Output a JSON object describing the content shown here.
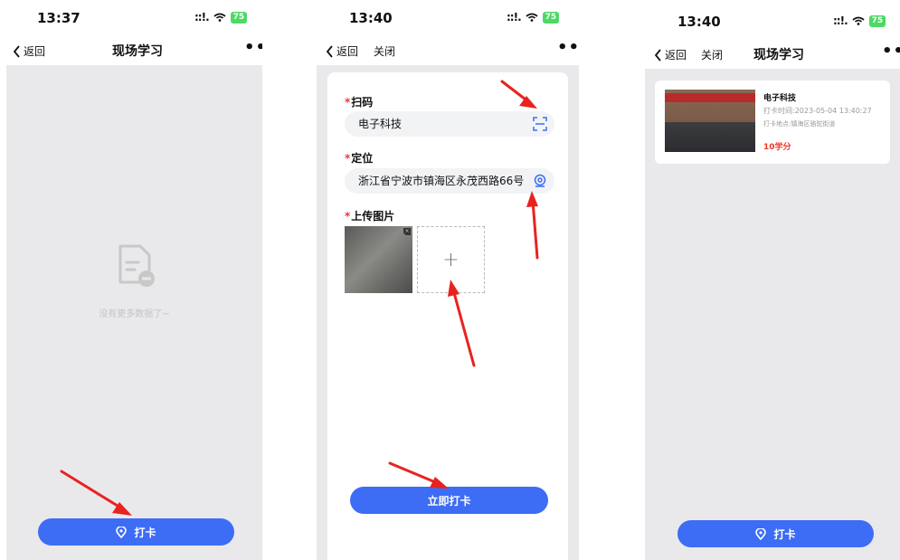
{
  "screen1": {
    "status": {
      "time": "13:37",
      "signal": "::!.",
      "battery": "75"
    },
    "nav": {
      "back": "返回",
      "title": "现场学习",
      "more": "•••"
    },
    "empty_text": "没有更多数据了~",
    "checkin_button": "打卡"
  },
  "screen2": {
    "status": {
      "time": "13:40",
      "signal": "::!.",
      "battery": "75"
    },
    "nav": {
      "back": "返回",
      "close": "关闭",
      "more": "•••"
    },
    "required_mark": "*",
    "scan_label": "扫码",
    "scan_value": "电子科技",
    "location_label": "定位",
    "location_value": "浙江省宁波市镇海区永茂西路66号",
    "upload_label": "上传图片",
    "add_symbol": "+",
    "submit_button": "立即打卡"
  },
  "screen3": {
    "status": {
      "time": "13:40",
      "signal": "::!.",
      "battery": "75"
    },
    "nav": {
      "back": "返回",
      "close": "关闭",
      "title": "现场学习",
      "more": "•••"
    },
    "record": {
      "title": "电子科技",
      "time": "打卡时间:2023-05-04 13:40:27",
      "place": "打卡地点:镇海区骆驼街道",
      "credit": "10学分"
    },
    "checkin_button": "打卡"
  },
  "colors": {
    "primary": "#3d6cf5",
    "required": "#f0392b",
    "arrow": "#e8231f",
    "background": "#e9e9eb"
  }
}
